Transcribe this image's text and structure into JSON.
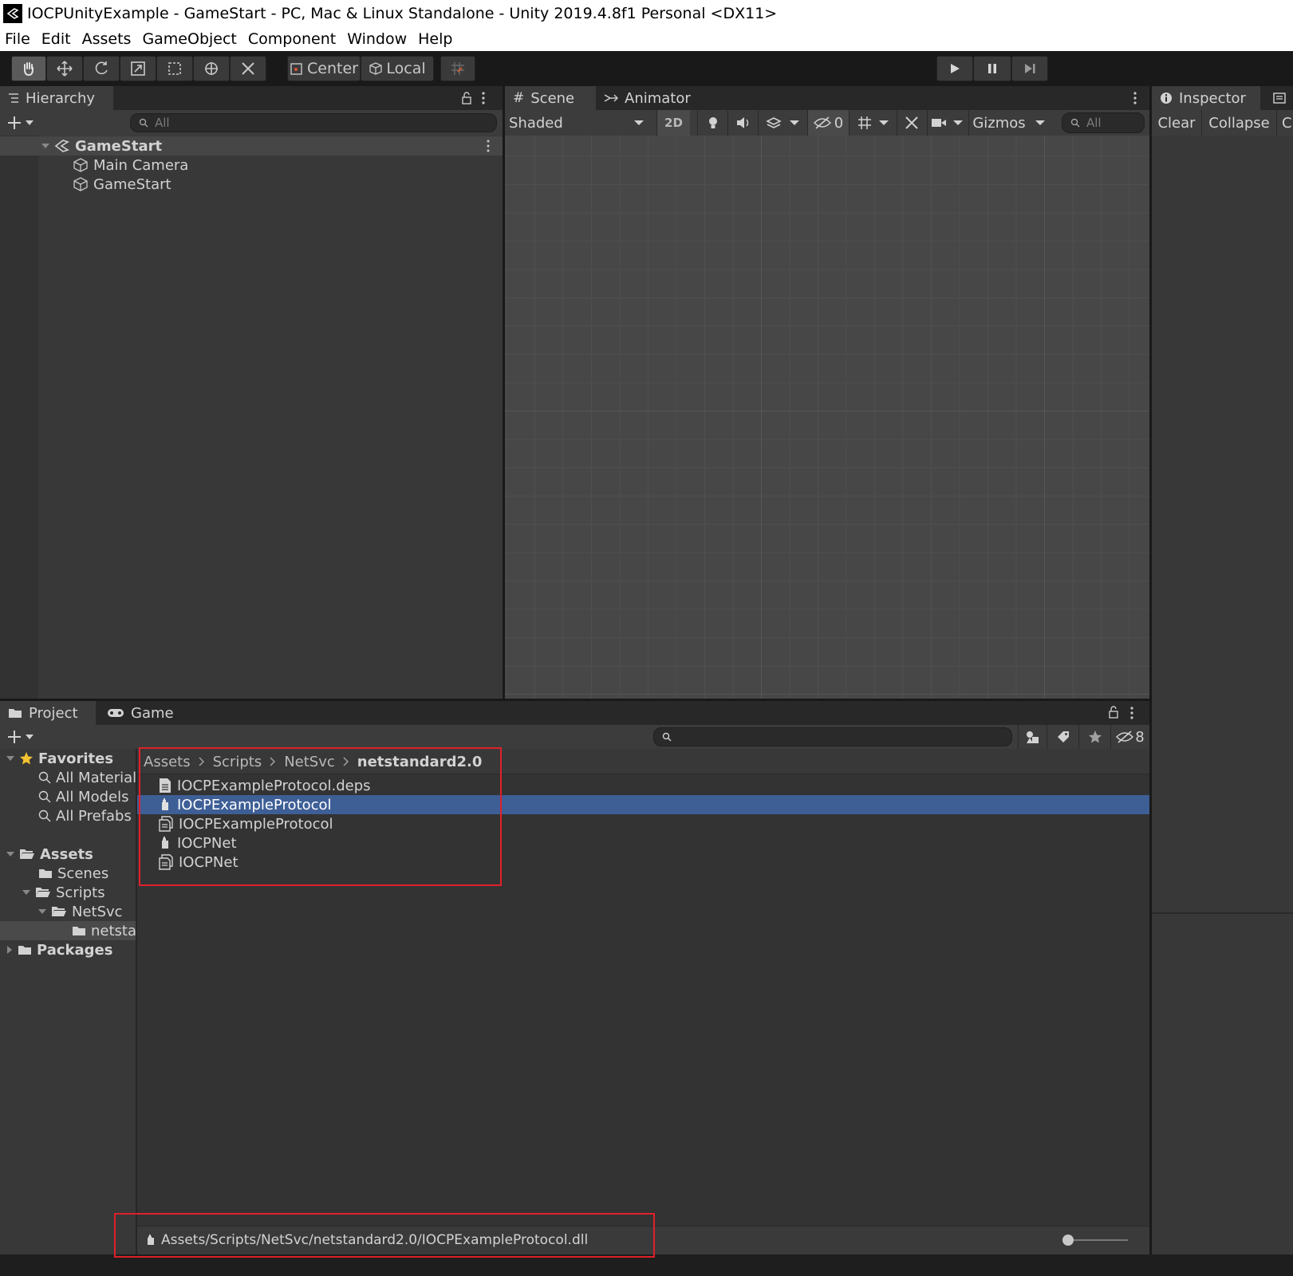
{
  "window": {
    "title": "IOCPUnityExample - GameStart - PC, Mac & Linux Standalone - Unity 2019.4.8f1 Personal <DX11>"
  },
  "menu": [
    "File",
    "Edit",
    "Assets",
    "GameObject",
    "Component",
    "Window",
    "Help"
  ],
  "toolbar": {
    "pivot_label": "Center",
    "space_label": "Local"
  },
  "hierarchy": {
    "tab_label": "Hierarchy",
    "search_placeholder": "All",
    "scene_name": "GameStart",
    "items": [
      "Main Camera",
      "GameStart"
    ]
  },
  "scene": {
    "tab_scene": "Scene",
    "tab_animator": "Animator",
    "draw_mode": "Shaded",
    "mode_2d": "2D",
    "hidden_count": "0",
    "gizmos_label": "Gizmos",
    "search_placeholder": "All"
  },
  "inspector": {
    "tab_label": "Inspector",
    "clear_label": "Clear",
    "collapse_label": "Collapse",
    "clipped_label": "C"
  },
  "project": {
    "tab_project": "Project",
    "tab_game": "Game",
    "hidden_count": "8",
    "favorites": {
      "label": "Favorites",
      "items": [
        "All Material",
        "All Models",
        "All Prefabs"
      ]
    },
    "tree": {
      "assets": "Assets",
      "scenes": "Scenes",
      "scripts": "Scripts",
      "netsvc": "NetSvc",
      "netstandard": "netstar",
      "packages": "Packages"
    },
    "breadcrumb": [
      "Assets",
      "Scripts",
      "NetSvc",
      "netstandard2.0"
    ],
    "files": [
      {
        "name": "IOCPExampleProtocol.deps",
        "icon": "text-file-icon"
      },
      {
        "name": "IOCPExampleProtocol",
        "icon": "dll-plugin-icon",
        "selected": true
      },
      {
        "name": "IOCPExampleProtocol",
        "icon": "pdb-file-icon"
      },
      {
        "name": "IOCPNet",
        "icon": "dll-plugin-icon"
      },
      {
        "name": "IOCPNet",
        "icon": "pdb-file-icon"
      }
    ],
    "status_path": "Assets/Scripts/NetSvc/netstandard2.0/IOCPExampleProtocol.dll"
  },
  "colors": {
    "selection": "#3e5f96",
    "highlight_box": "#e0202a",
    "panel_bg": "#383838",
    "toolbar_bg": "#191919"
  }
}
